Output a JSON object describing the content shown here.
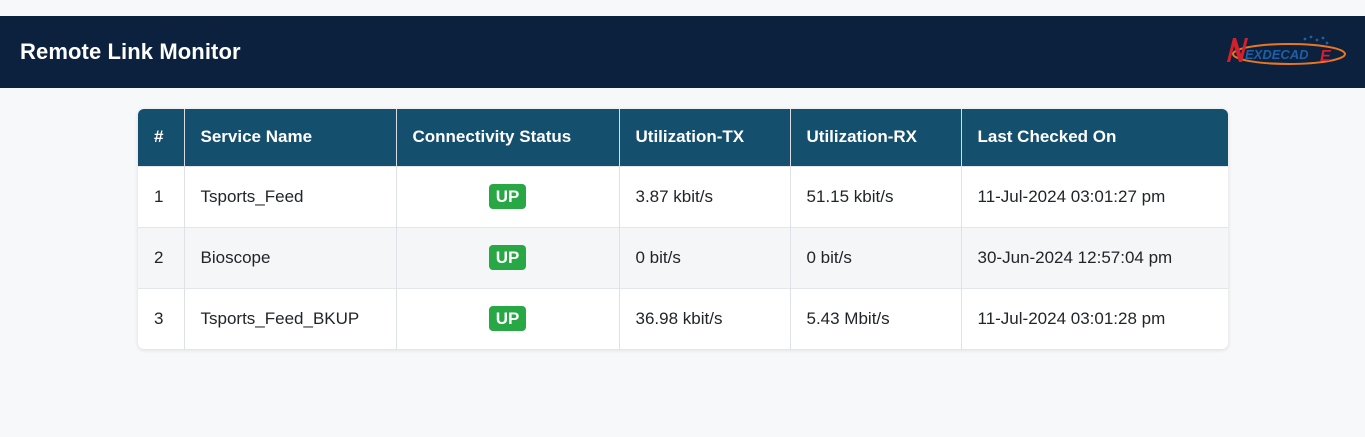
{
  "header": {
    "title": "Remote Link Monitor",
    "logo_text": "NEXDECADE"
  },
  "table": {
    "columns": [
      "#",
      "Service Name",
      "Connectivity Status",
      "Utilization-TX",
      "Utilization-RX",
      "Last Checked On"
    ],
    "rows": [
      {
        "num": "1",
        "service": "Tsports_Feed",
        "status": "UP",
        "tx": "3.87 kbit/s",
        "rx": "51.15 kbit/s",
        "checked": "11-Jul-2024 03:01:27 pm"
      },
      {
        "num": "2",
        "service": "Bioscope",
        "status": "UP",
        "tx": "0 bit/s",
        "rx": "0 bit/s",
        "checked": "30-Jun-2024 12:57:04 pm"
      },
      {
        "num": "3",
        "service": "Tsports_Feed_BKUP",
        "status": "UP",
        "tx": "36.98 kbit/s",
        "rx": "5.43 Mbit/s",
        "checked": "11-Jul-2024 03:01:28 pm"
      }
    ]
  },
  "colors": {
    "navbar": "#0c213d",
    "table_header": "#154f6e",
    "status_up": "#28a745",
    "logo_red": "#d4202a",
    "logo_blue": "#1f5fa8",
    "logo_orange": "#e87722"
  }
}
